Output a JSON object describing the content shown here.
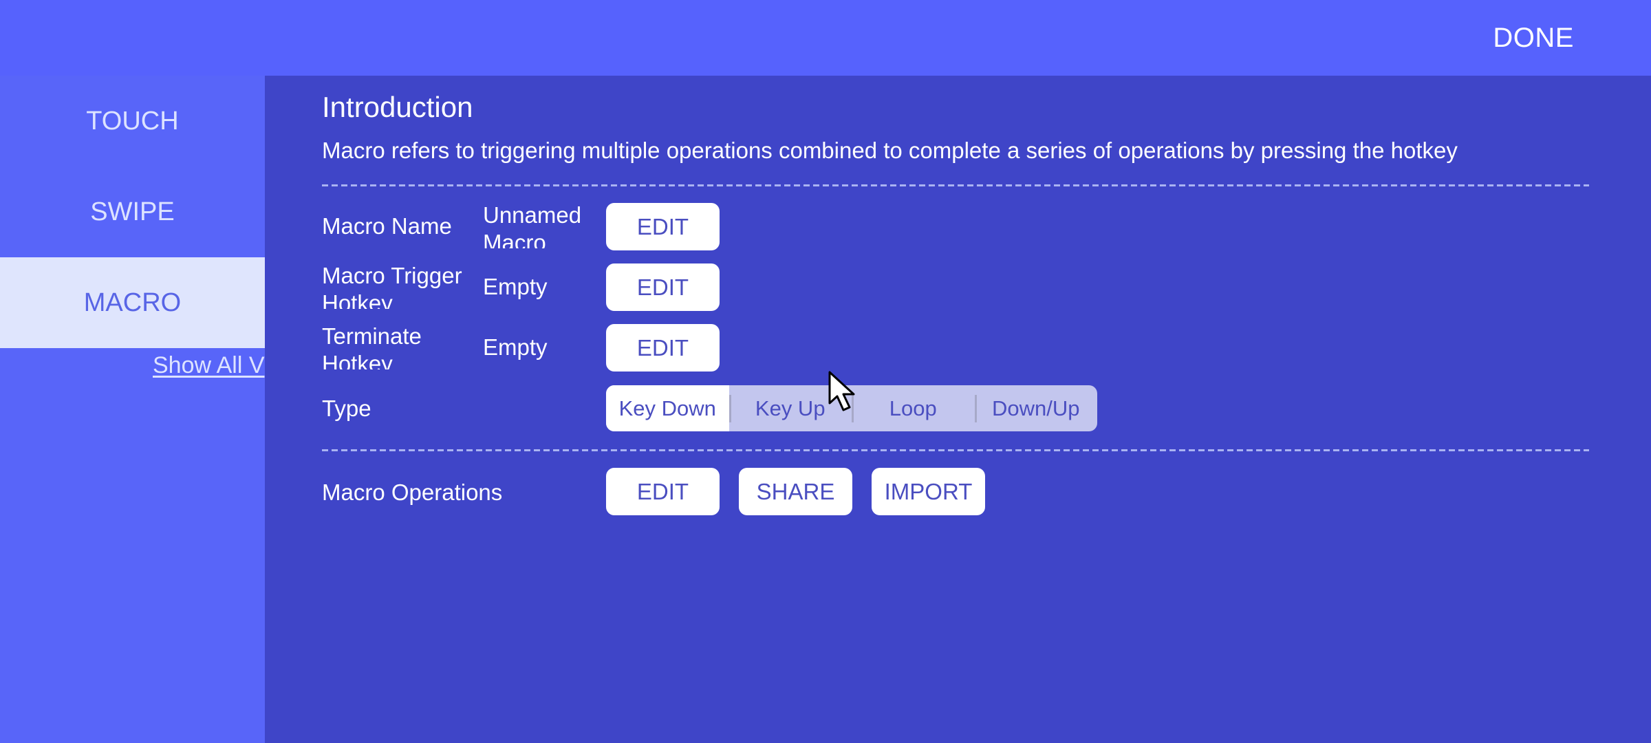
{
  "header": {
    "done_label": "DONE"
  },
  "sidebar": {
    "items": [
      {
        "label": "TOUCH",
        "active": false
      },
      {
        "label": "SWIPE",
        "active": false
      },
      {
        "label": "MACRO",
        "active": true
      }
    ],
    "show_all_label": "Show All V"
  },
  "main": {
    "intro_title": "Introduction",
    "intro_description": "Macro refers to triggering multiple operations combined to complete a series of operations by pressing the hotkey",
    "rows": [
      {
        "label": "Macro Name",
        "value": "Unnamed Macro",
        "button": "EDIT"
      },
      {
        "label": "Macro Trigger Hotkey",
        "value": "Empty",
        "button": "EDIT"
      },
      {
        "label": "Terminate Hotkey",
        "value": "Empty",
        "button": "EDIT"
      }
    ],
    "type": {
      "label": "Type",
      "options": [
        "Key Down",
        "Key Up",
        "Loop",
        "Down/Up"
      ],
      "selected": "Key Down"
    },
    "operations": {
      "label": "Macro Operations",
      "buttons": [
        "EDIT",
        "SHARE",
        "IMPORT"
      ]
    }
  },
  "colors": {
    "header_bg": "#5662fd",
    "sidebar_bg": "#5865f9",
    "sidebar_active_bg": "#dfe5fd",
    "panel_bg": "#3f45c8",
    "button_text": "#4a4ec0",
    "segment_unselected_bg": "#c3c6ee"
  },
  "icons": {
    "cursor": "mouse-pointer-arrow"
  }
}
